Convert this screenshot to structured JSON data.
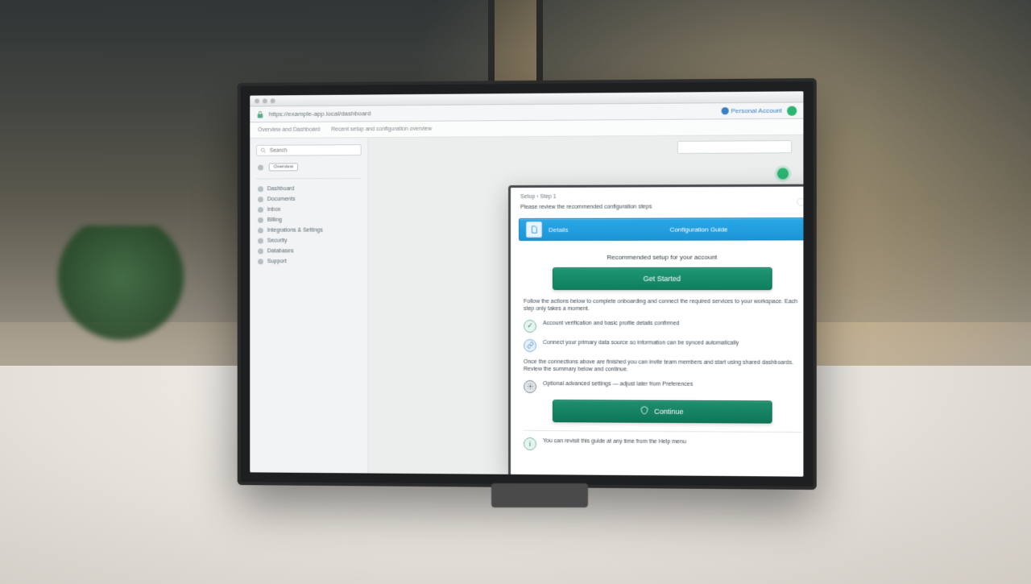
{
  "chrome": {
    "address": "https://example-app.local/dashboard",
    "account_label": "Personal Account",
    "toolbar": {
      "item1": "Overview and Dashboard",
      "item2": "Recent setup and configuration overview"
    }
  },
  "sidebar": {
    "search_placeholder": "Search",
    "chip": "Overview",
    "items": [
      "Dashboard",
      "Documents",
      "Inbox",
      "Billing",
      "Integrations & Settings",
      "Security",
      "Databases",
      "Support"
    ]
  },
  "modal": {
    "breadcrumb": "Setup › Step 1",
    "subtitle": "Please review the recommended configuration steps",
    "blue_bar": {
      "left": "Details",
      "center": "Configuration Guide"
    },
    "step_title": "Recommended setup for your account",
    "primary_button": "Get Started",
    "para1": "Follow the actions below to complete onboarding and connect the required services to your workspace. Each step only takes a moment.",
    "bullets": [
      {
        "variant": "green",
        "text": "Account verification and basic profile details confirmed"
      },
      {
        "variant": "blue",
        "text": "Connect your primary data source so information can be synced automatically"
      }
    ],
    "para2": "Once the connections above are finished you can invite team members and start using shared dashboards. Review the summary below and continue.",
    "bullets2": [
      {
        "variant": "dark",
        "text": "Optional advanced settings — adjust later from Preferences"
      }
    ],
    "secondary_button": "Continue",
    "footer_bullet": {
      "variant": "green",
      "text": "You can revisit this guide at any time from the Help menu"
    }
  }
}
